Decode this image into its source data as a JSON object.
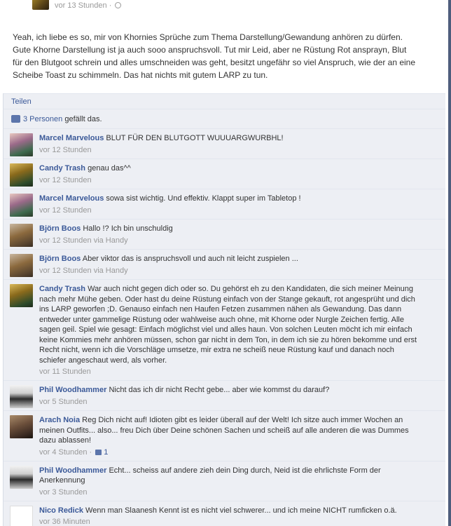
{
  "post": {
    "time": "vor 13 Stunden",
    "dot": "·",
    "text": "Yeah, ich liebe es so, mir von Khornies Sprüche zum Thema Darstellung/Gewandung anhören zu dürfen. Gute Khorne Darstellung ist ja auch sooo anspruchsvoll. Tut mir Leid, aber ne Rüstung Rot ansprayn, Blut für den Blutgoot schrein und alles umschneiden was geht, besitzt ungefähr so viel Anspruch, wie der an eine Scheibe Toast zu schimmeln. Das hat nichts mit gutem LARP zu tun."
  },
  "share_label": "Teilen",
  "likes": {
    "count_label": "3 Personen",
    "suffix": "gefällt das."
  },
  "comments": [
    {
      "name": "Marcel Marvelous",
      "text": "BLUT FÜR DEN BLUTGOTT WUUUARGWURBHL!",
      "time": "vor 12 Stunden",
      "via": ""
    },
    {
      "name": "Candy Trash",
      "text": "genau das^^",
      "time": "vor 12 Stunden",
      "via": ""
    },
    {
      "name": "Marcel Marvelous",
      "text": "sowa sist wichtig. Und effektiv. Klappt super im Tabletop !",
      "time": "vor 12 Stunden",
      "via": ""
    },
    {
      "name": "Björn Boos",
      "text": "Hallo !? Ich bin unschuldig",
      "time": "vor 12 Stunden",
      "via": "via Handy"
    },
    {
      "name": "Björn Boos",
      "text": "Aber viktor das is anspruchsvoll und auch nit leicht zuspielen ...",
      "time": "vor 12 Stunden",
      "via": "via Handy"
    },
    {
      "name": "Candy Trash",
      "text": "War auch nicht gegen dich oder so. Du gehörst eh zu den Kandidaten, die sich meiner Meinung nach mehr Mühe geben. Oder hast du deine Rüstung einfach von der Stange gekauft, rot angesprüht und dich ins LARP geworfen ;D. Genauso einfach nen Haufen Fetzen zusammen nähen als Gewandung. Das dann entweder unter gammelige Rüstung oder wahlweise auch ohne, mit Khorne oder Nurgle Zeichen fertig. Alle sagen geil. Spiel wie gesagt: Einfach möglichst viel und alles haun. Von solchen Leuten möcht ich mir einfach keine Kommies mehr anhören müssen, schon gar nicht in dem Ton, in dem ich sie zu hören bekomme und erst Recht nicht, wenn ich die Vorschläge umsetze, mir extra ne scheiß neue Rüstung kauf und danach noch schiefer angeschaut werd, als vorher.",
      "time": "vor 11 Stunden",
      "via": ""
    },
    {
      "name": "Phil Woodhammer",
      "text": "Nicht das ich dir nicht Recht gebe... aber wie kommst du darauf?",
      "time": "vor 5 Stunden",
      "via": ""
    },
    {
      "name": "Arach Noia",
      "text": "Reg Dich nicht auf! Idioten gibt es leider überall auf der Welt! Ich sitze auch immer Wochen an meinen Outfits... also... freu Dich über Deine schönen Sachen und scheiß auf alle anderen die was Dummes dazu ablassen!",
      "time": "vor 4 Stunden",
      "via": "",
      "likes": "1"
    },
    {
      "name": "Phil Woodhammer",
      "text": "Echt... scheiss auf andere zieh dein Ding durch, Neid ist die ehrlichste Form der Anerkennung",
      "time": "vor 3 Stunden",
      "via": ""
    },
    {
      "name": "Nico Redick",
      "text": "Wenn man Slaanesh Kennt ist es nicht viel schwerer... und ich meine NICHT rumficken o.ä.",
      "time": "vor 36 Minuten",
      "via": ""
    }
  ]
}
